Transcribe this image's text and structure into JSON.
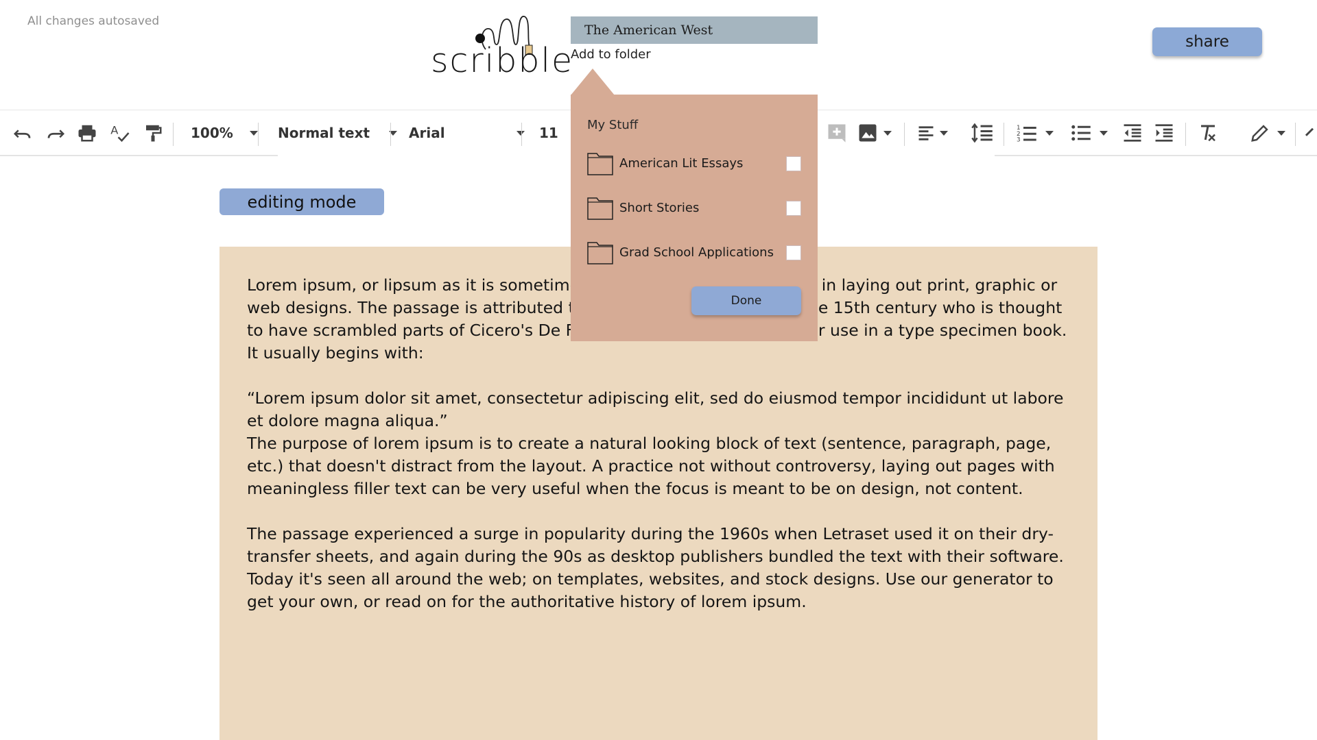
{
  "header": {
    "autosave_status": "All changes autosaved",
    "logo_text": "scribble",
    "document_title": "The American West",
    "add_to_folder_label": "Add to folder",
    "share_label": "share"
  },
  "toolbar": {
    "icons": [
      "undo-icon",
      "redo-icon",
      "print-icon",
      "spellcheck-icon",
      "paint-format-icon",
      "insert-comment-icon",
      "insert-image-icon",
      "align-icon",
      "line-spacing-icon",
      "numbered-list-icon",
      "bulleted-list-icon",
      "decrease-indent-icon",
      "increase-indent-icon",
      "clear-formatting-icon",
      "editing-pen-icon"
    ],
    "zoom": "100%",
    "paragraph_style": "Normal text",
    "font": "Arial",
    "font_size": "11"
  },
  "mode_label": "editing mode",
  "document": {
    "paragraphs": [
      "Lorem ipsum, or lipsum as it is sometimes known, is dummy text used in laying out print, graphic or web designs. The passage is attributed to an unknown typesetter in the 15th century who is thought to have scrambled parts of Cicero's De Finibus Bonorum et Malorum for use in a type specimen book. It usually begins with:",
      "“Lorem ipsum dolor sit amet, consectetur adipiscing elit, sed do eiusmod tempor incididunt ut labore et dolore magna aliqua.”",
      "The purpose of lorem ipsum is to create a natural looking block of text (sentence, paragraph, page, etc.) that doesn't distract from the layout. A practice not without controversy, laying out pages with meaningless filler text can be very useful when the focus is meant to be on design, not content.",
      "The passage experienced a surge in popularity during the 1960s when Letraset used it on their dry-transfer sheets, and again during the 90s as desktop publishers bundled the text with their software. Today it's seen all around the web; on templates, websites, and stock designs. Use our generator to get your own, or read on for the authoritative history of lorem ipsum."
    ]
  },
  "folder_popup": {
    "heading": "My Stuff",
    "folders": [
      {
        "name": "American Lit Essays",
        "checked": false,
        "icon": "folder-icon"
      },
      {
        "name": "Short Stories",
        "checked": false,
        "icon": "folder-icon"
      },
      {
        "name": "Grad School Applications",
        "checked": false,
        "icon": "folder-icon"
      }
    ],
    "done_label": "Done"
  },
  "colors": {
    "share_button": "#8ca9d6",
    "mode_button": "#8fa9d5",
    "page_background": "#ecd9bf",
    "folder_panel": "#d6ab95",
    "title_box": "#a5b5bf"
  }
}
